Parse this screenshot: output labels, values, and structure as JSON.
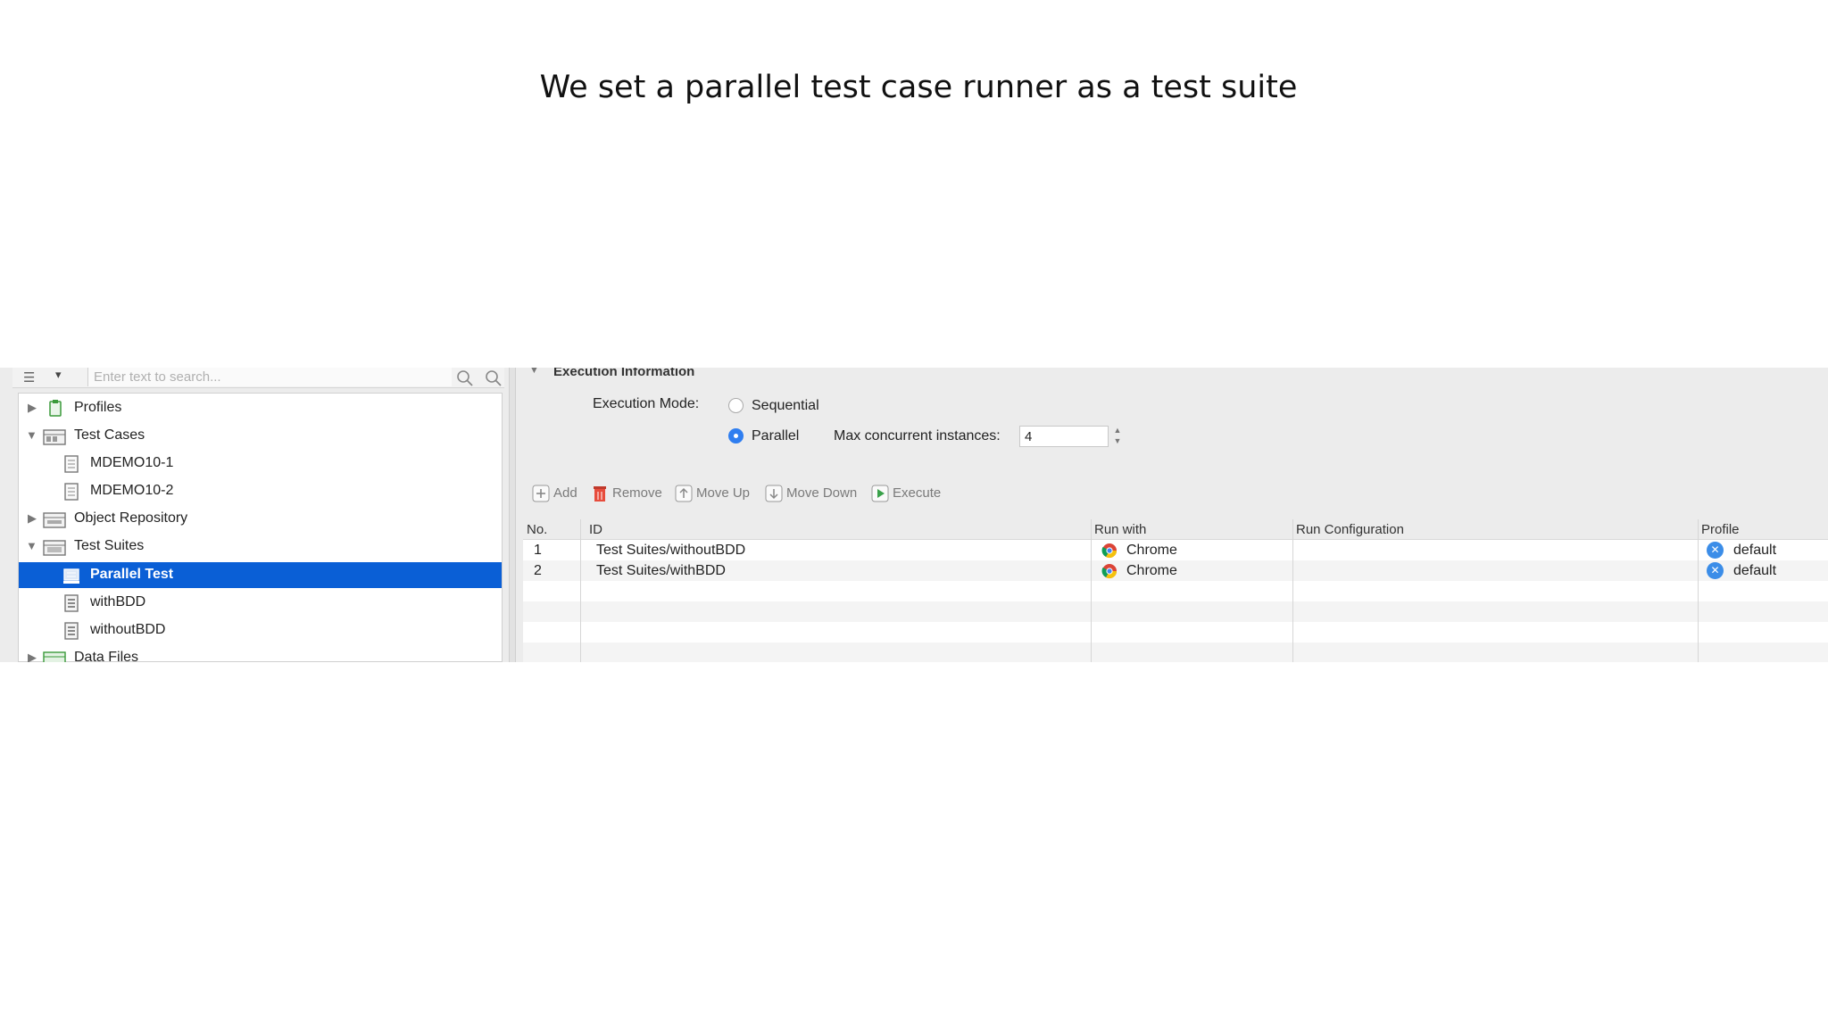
{
  "slide": {
    "title": "We set a parallel test case runner as a test suite"
  },
  "explorer": {
    "search_placeholder": "Enter text to search...",
    "tree": [
      {
        "label": "Profiles",
        "expanded": false,
        "level": 0,
        "icon": "profiles-icon"
      },
      {
        "label": "Test Cases",
        "expanded": true,
        "level": 0,
        "icon": "test-cases-folder-icon"
      },
      {
        "label": "MDEMO10-1",
        "level": 1,
        "icon": "test-case-icon"
      },
      {
        "label": "MDEMO10-2",
        "level": 1,
        "icon": "test-case-icon"
      },
      {
        "label": "Object Repository",
        "expanded": false,
        "level": 0,
        "icon": "object-repository-icon"
      },
      {
        "label": "Test Suites",
        "expanded": true,
        "level": 0,
        "icon": "test-suites-folder-icon"
      },
      {
        "label": "Parallel Test",
        "level": 1,
        "icon": "test-suite-collection-icon",
        "selected": true
      },
      {
        "label": "withBDD",
        "level": 1,
        "icon": "test-suite-icon"
      },
      {
        "label": "withoutBDD",
        "level": 1,
        "icon": "test-suite-icon"
      },
      {
        "label": "Data Files",
        "expanded": false,
        "level": 0,
        "icon": "data-files-icon"
      }
    ]
  },
  "execution": {
    "section_title": "Execution Information",
    "mode_label": "Execution Mode:",
    "sequential_label": "Sequential",
    "parallel_label": "Parallel",
    "selected_mode": "Parallel",
    "max_label": "Max concurrent instances:",
    "max_value": "4"
  },
  "toolbar": {
    "add": "Add",
    "remove": "Remove",
    "move_up": "Move Up",
    "move_down": "Move Down",
    "execute": "Execute"
  },
  "table": {
    "headers": {
      "no": "No.",
      "id": "ID",
      "run_with": "Run with",
      "run_config": "Run Configuration",
      "profile": "Profile"
    },
    "rows": [
      {
        "no": "1",
        "id": "Test Suites/withoutBDD",
        "run_with": "Chrome",
        "run_config": "",
        "profile": "default"
      },
      {
        "no": "2",
        "id": "Test Suites/withBDD",
        "run_with": "Chrome",
        "run_config": "",
        "profile": "default"
      }
    ]
  },
  "colors": {
    "selection": "#0a5fd6",
    "radio_on": "#2f7ef0",
    "profile_icon": "#3b8de8"
  }
}
